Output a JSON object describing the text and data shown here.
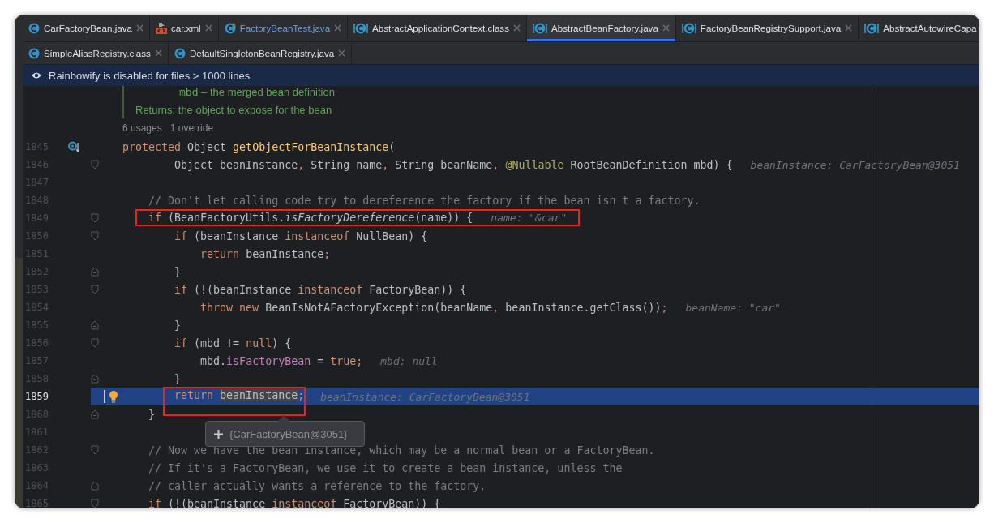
{
  "tab_rows": [
    {
      "tabs": [
        {
          "label": "CarFactoryBean.java",
          "kind": "class",
          "selected": false,
          "modified": false,
          "closable": true
        },
        {
          "label": "car.xml",
          "kind": "xml",
          "selected": false,
          "modified": false,
          "closable": true
        },
        {
          "label": "FactoryBeanTest.java",
          "kind": "test",
          "selected": false,
          "modified": true,
          "closable": true
        },
        {
          "label": "AbstractApplicationContext.class",
          "kind": "compiled",
          "selected": false,
          "modified": false,
          "closable": true
        },
        {
          "label": "AbstractBeanFactory.java",
          "kind": "compiled",
          "selected": true,
          "modified": false,
          "closable": true
        },
        {
          "label": "FactoryBeanRegistrySupport.java",
          "kind": "compiled",
          "selected": false,
          "modified": false,
          "closable": true
        },
        {
          "label": "AbstractAutowireCapa",
          "kind": "compiled",
          "selected": false,
          "modified": false,
          "closable": false
        }
      ]
    },
    {
      "tabs": [
        {
          "label": "SimpleAliasRegistry.class",
          "kind": "class",
          "selected": false,
          "modified": false,
          "closable": true
        },
        {
          "label": "DefaultSingletonBeanRegistry.java",
          "kind": "class",
          "selected": false,
          "modified": false,
          "closable": true
        }
      ]
    }
  ],
  "banner": {
    "text": "Rainbowify is disabled for files > 1000 lines"
  },
  "doc": {
    "param_name": "mbd",
    "param_text": "– the merged bean definition",
    "returns_label": "Returns:",
    "returns_text": "the object to expose for the bean"
  },
  "usages": [
    "6 usages",
    "1 override"
  ],
  "lines": [
    {
      "number": "1845",
      "current": false,
      "gutter_icon": {
        "kind": "override"
      },
      "tokens": [
        {
          "kind": "keyword",
          "text": "protected"
        },
        {
          "kind": "plain",
          "text": " Object "
        },
        {
          "kind": "method",
          "text": "getObjectForBeanInstance"
        },
        {
          "kind": "plain",
          "text": "("
        }
      ]
    },
    {
      "number": "1846",
      "current": false,
      "fold": {
        "kind": "start"
      },
      "tokens": [
        {
          "kind": "plain",
          "text": "        Object beanInstance"
        },
        {
          "kind": "keyword",
          "text": ","
        },
        {
          "kind": "plain",
          "text": " String name"
        },
        {
          "kind": "keyword",
          "text": ","
        },
        {
          "kind": "plain",
          "text": " String beanName"
        },
        {
          "kind": "keyword",
          "text": ","
        },
        {
          "kind": "annotation",
          "text": " @Nullable"
        },
        {
          "kind": "plain",
          "text": " RootBeanDefinition mbd) {"
        }
      ],
      "hint": "beanInstance: CarFactoryBean@3051"
    },
    {
      "number": "1847",
      "current": false
    },
    {
      "number": "1848",
      "current": false,
      "tokens": [
        {
          "kind": "comment",
          "text": "    // Don't let calling code try to dereference the factory if the bean isn't a factory."
        }
      ]
    },
    {
      "number": "1849",
      "current": false,
      "fold": {
        "kind": "start"
      },
      "box": {
        "kind": "with_hint"
      },
      "tokens": [
        {
          "kind": "keyword",
          "text": "    if"
        },
        {
          "kind": "plain",
          "text": " (BeanFactoryUtils."
        },
        {
          "kind": "italic",
          "text": "isFactoryDereference"
        },
        {
          "kind": "plain",
          "text": "(name)) {"
        }
      ],
      "hint": "name: \"&car\""
    },
    {
      "number": "1850",
      "current": false,
      "fold": {
        "kind": "start"
      },
      "tokens": [
        {
          "kind": "keyword",
          "text": "        if"
        },
        {
          "kind": "plain",
          "text": " (beanInstance "
        },
        {
          "kind": "keyword",
          "text": "instanceof"
        },
        {
          "kind": "plain",
          "text": " NullBean) {"
        }
      ]
    },
    {
      "number": "1851",
      "current": false,
      "tokens": [
        {
          "kind": "keyword",
          "text": "            return"
        },
        {
          "kind": "plain",
          "text": " beanInstance"
        },
        {
          "kind": "keyword",
          "text": ";"
        }
      ]
    },
    {
      "number": "1852",
      "current": false,
      "fold": {
        "kind": "end"
      },
      "tokens": [
        {
          "kind": "plain",
          "text": "        }"
        }
      ]
    },
    {
      "number": "1853",
      "current": false,
      "fold": {
        "kind": "start"
      },
      "tokens": [
        {
          "kind": "keyword",
          "text": "        if"
        },
        {
          "kind": "plain",
          "text": " (!(beanInstance "
        },
        {
          "kind": "keyword",
          "text": "instanceof"
        },
        {
          "kind": "plain",
          "text": " FactoryBean)) {"
        }
      ]
    },
    {
      "number": "1854",
      "current": false,
      "tokens": [
        {
          "kind": "keyword",
          "text": "            throw new"
        },
        {
          "kind": "plain",
          "text": " BeanIsNotAFactoryException(beanName"
        },
        {
          "kind": "keyword",
          "text": ","
        },
        {
          "kind": "plain",
          "text": " beanInstance.getClass())"
        },
        {
          "kind": "keyword",
          "text": ";"
        }
      ],
      "hint": "beanName: \"car\""
    },
    {
      "number": "1855",
      "current": false,
      "fold": {
        "kind": "end"
      },
      "tokens": [
        {
          "kind": "plain",
          "text": "        }"
        }
      ]
    },
    {
      "number": "1856",
      "current": false,
      "fold": {
        "kind": "start"
      },
      "tokens": [
        {
          "kind": "keyword",
          "text": "        if"
        },
        {
          "kind": "plain",
          "text": " (mbd != "
        },
        {
          "kind": "keyword",
          "text": "null"
        },
        {
          "kind": "plain",
          "text": ") {"
        }
      ]
    },
    {
      "number": "1857",
      "current": false,
      "tokens": [
        {
          "kind": "plain",
          "text": "            mbd."
        },
        {
          "kind": "field",
          "text": "isFactoryBean"
        },
        {
          "kind": "plain",
          "text": " = "
        },
        {
          "kind": "keyword",
          "text": "true;"
        }
      ],
      "hint": "mbd: null"
    },
    {
      "number": "1858",
      "current": false,
      "fold": {
        "kind": "end"
      },
      "tokens": [
        {
          "kind": "plain",
          "text": "        }"
        }
      ]
    },
    {
      "number": "1859",
      "current": true,
      "gutter_icon": {
        "kind": "bulb"
      },
      "box": {
        "kind": "code"
      },
      "tokens": [
        {
          "kind": "keyword",
          "text": "        return "
        },
        {
          "kind": "selected",
          "text": "beanInstance"
        },
        {
          "kind": "keyword",
          "text": ";"
        }
      ],
      "hint": "beanInstance: CarFactoryBean@3051"
    },
    {
      "number": "1860",
      "current": false,
      "fold": {
        "kind": "end"
      },
      "tokens": [
        {
          "kind": "plain",
          "text": "    }"
        }
      ]
    },
    {
      "number": "1861",
      "current": false
    },
    {
      "number": "1862",
      "current": false,
      "fold": {
        "kind": "start"
      },
      "tokens": [
        {
          "kind": "comment",
          "text": "    // Now we have the bean instance, which may be a normal bean or a FactoryBean."
        }
      ]
    },
    {
      "number": "1863",
      "current": false,
      "tokens": [
        {
          "kind": "comment",
          "text": "    // If it's a FactoryBean, we use it to create a bean instance, unless the"
        }
      ]
    },
    {
      "number": "1864",
      "current": false,
      "fold": {
        "kind": "end"
      },
      "tokens": [
        {
          "kind": "comment",
          "text": "    // caller actually wants a reference to the factory."
        }
      ]
    },
    {
      "number": "1865",
      "current": false,
      "fold": {
        "kind": "start"
      },
      "tokens": [
        {
          "kind": "keyword",
          "text": "    if"
        },
        {
          "kind": "plain",
          "text": " (!(beanInstance "
        },
        {
          "kind": "keyword",
          "text": "instanceof"
        },
        {
          "kind": "plain",
          "text": " FactoryBean)) {"
        }
      ]
    }
  ],
  "tooltip": {
    "text": "{CarFactoryBean@3051}"
  }
}
